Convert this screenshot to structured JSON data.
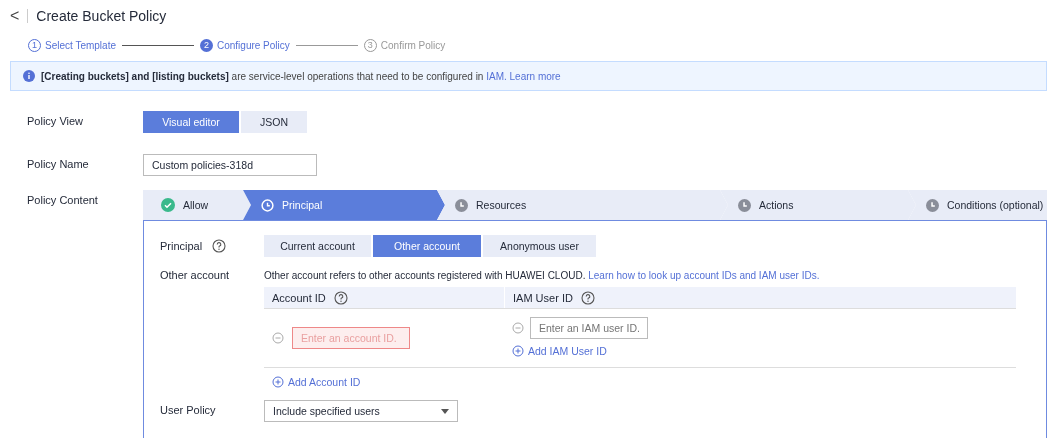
{
  "header": {
    "back": "<",
    "title": "Create Bucket Policy"
  },
  "steps": [
    {
      "number": "1",
      "label": "Select Template",
      "completed": true,
      "selected": false
    },
    {
      "number": "2",
      "label": "Configure Policy",
      "completed": false,
      "selected": true
    },
    {
      "number": "3",
      "label": "Confirm Policy",
      "completed": false,
      "selected": false
    }
  ],
  "notice": {
    "text": "**[Creating buckets] and [listing buckets]** are service-level operations that need to be configured in ",
    "link": "IAM.",
    "link2": "Learn more"
  },
  "form": {
    "policy_view": {
      "label": "Policy View",
      "options": [
        {
          "label": "Visual editor",
          "selected": true
        },
        {
          "label": "JSON",
          "selected": false
        }
      ]
    },
    "policy_name": {
      "label": "Policy Name",
      "value": "Custom policies-318d"
    },
    "policy_content": {
      "label": "Policy Content"
    }
  },
  "stages": [
    {
      "label": "Allow",
      "completed": true,
      "selected": false
    },
    {
      "label": "Principal",
      "completed": false,
      "selected": true
    },
    {
      "label": "Resources",
      "completed": false,
      "selected": false
    },
    {
      "label": "Actions",
      "completed": false,
      "selected": false
    },
    {
      "label": "Conditions (optional)",
      "completed": false,
      "selected": false
    }
  ],
  "principal": {
    "label": "Principal",
    "options": [
      {
        "label": "Current account",
        "selected": false
      },
      {
        "label": "Other account",
        "selected": true
      },
      {
        "label": "Anonymous user",
        "selected": false
      }
    ]
  },
  "other_account": {
    "label": "Other account",
    "description": "Other account refers to other accounts registered with HUAWEI CLOUD. ",
    "link": "Learn how to look up account IDs and IAM user IDs.",
    "columns": [
      "Account ID",
      "IAM User ID"
    ],
    "account_placeholder": "Enter an account ID.",
    "account_error": true,
    "user_placeholder": "Enter an IAM user ID.",
    "add_user": "Add IAM User ID",
    "add_account": "Add Account ID"
  },
  "user_policy": {
    "label": "User Policy",
    "value": "Include specified users"
  }
}
